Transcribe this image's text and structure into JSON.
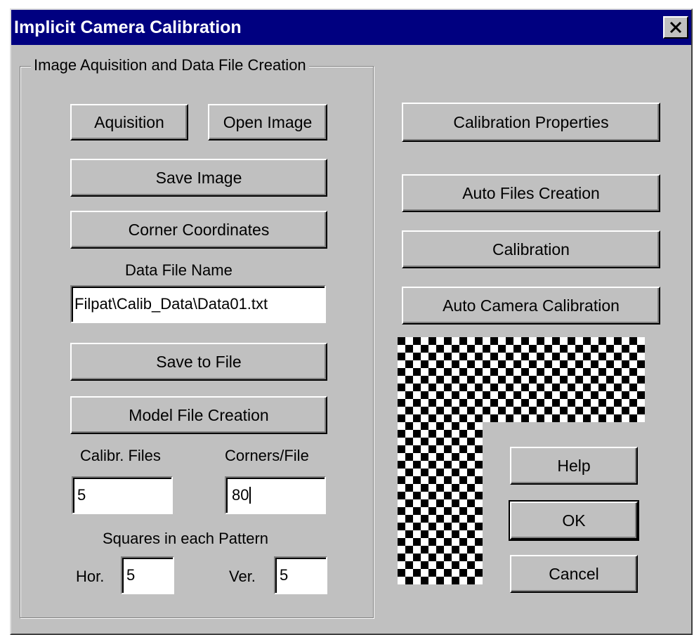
{
  "window": {
    "title": "Implicit Camera Calibration",
    "close_icon": "close-icon"
  },
  "group": {
    "label": "Image Aquisition and Data File Creation",
    "aquisition_label": "Aquisition",
    "open_image_label": "Open Image",
    "save_image_label": "Save Image",
    "corner_coordinates_label": "Corner Coordinates",
    "data_file_name_label": "Data File Name",
    "data_file_name_value": "Filpat\\Calib_Data\\Data01.txt",
    "save_to_file_label": "Save to File",
    "model_file_creation_label": "Model File Creation",
    "calibr_files_label": "Calibr. Files",
    "calibr_files_value": "5",
    "corners_per_file_label": "Corners/File",
    "corners_per_file_value": "80",
    "squares_label": "Squares in each Pattern",
    "hor_label": "Hor.",
    "hor_value": "5",
    "ver_label": "Ver.",
    "ver_value": "5"
  },
  "right": {
    "calibration_properties_label": "Calibration Properties",
    "auto_files_creation_label": "Auto Files Creation",
    "calibration_label": "Calibration",
    "auto_camera_calibration_label": "Auto Camera Calibration",
    "help_label": "Help",
    "ok_label": "OK",
    "cancel_label": "Cancel"
  },
  "pattern_icon": "checkerboard-pattern-icon",
  "colors": {
    "title_bar": "#000080",
    "face": "#c0c0c0",
    "pattern_dark": "#000000",
    "pattern_light": "#ffffff"
  }
}
